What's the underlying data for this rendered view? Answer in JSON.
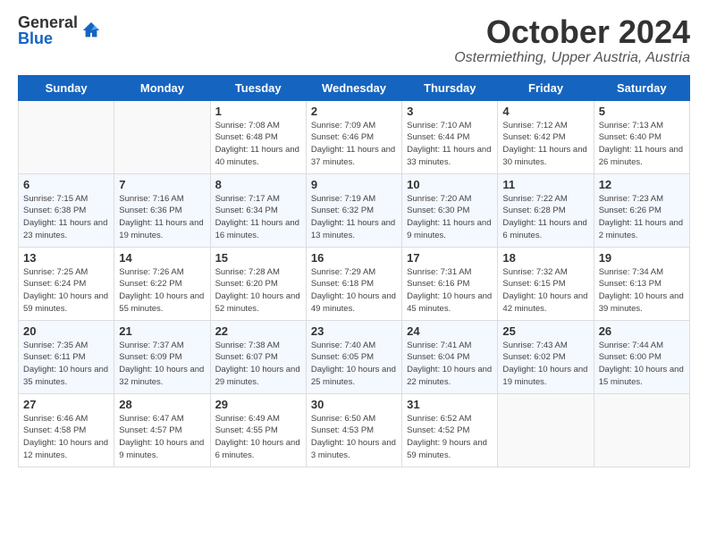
{
  "header": {
    "logo_general": "General",
    "logo_blue": "Blue",
    "month_title": "October 2024",
    "subtitle": "Ostermiething, Upper Austria, Austria"
  },
  "days_of_week": [
    "Sunday",
    "Monday",
    "Tuesday",
    "Wednesday",
    "Thursday",
    "Friday",
    "Saturday"
  ],
  "weeks": [
    [
      {
        "day": "",
        "empty": true
      },
      {
        "day": "",
        "empty": true
      },
      {
        "day": "1",
        "sunrise": "7:08 AM",
        "sunset": "6:48 PM",
        "daylight": "11 hours and 40 minutes."
      },
      {
        "day": "2",
        "sunrise": "7:09 AM",
        "sunset": "6:46 PM",
        "daylight": "11 hours and 37 minutes."
      },
      {
        "day": "3",
        "sunrise": "7:10 AM",
        "sunset": "6:44 PM",
        "daylight": "11 hours and 33 minutes."
      },
      {
        "day": "4",
        "sunrise": "7:12 AM",
        "sunset": "6:42 PM",
        "daylight": "11 hours and 30 minutes."
      },
      {
        "day": "5",
        "sunrise": "7:13 AM",
        "sunset": "6:40 PM",
        "daylight": "11 hours and 26 minutes."
      }
    ],
    [
      {
        "day": "6",
        "sunrise": "7:15 AM",
        "sunset": "6:38 PM",
        "daylight": "11 hours and 23 minutes."
      },
      {
        "day": "7",
        "sunrise": "7:16 AM",
        "sunset": "6:36 PM",
        "daylight": "11 hours and 19 minutes."
      },
      {
        "day": "8",
        "sunrise": "7:17 AM",
        "sunset": "6:34 PM",
        "daylight": "11 hours and 16 minutes."
      },
      {
        "day": "9",
        "sunrise": "7:19 AM",
        "sunset": "6:32 PM",
        "daylight": "11 hours and 13 minutes."
      },
      {
        "day": "10",
        "sunrise": "7:20 AM",
        "sunset": "6:30 PM",
        "daylight": "11 hours and 9 minutes."
      },
      {
        "day": "11",
        "sunrise": "7:22 AM",
        "sunset": "6:28 PM",
        "daylight": "11 hours and 6 minutes."
      },
      {
        "day": "12",
        "sunrise": "7:23 AM",
        "sunset": "6:26 PM",
        "daylight": "11 hours and 2 minutes."
      }
    ],
    [
      {
        "day": "13",
        "sunrise": "7:25 AM",
        "sunset": "6:24 PM",
        "daylight": "10 hours and 59 minutes."
      },
      {
        "day": "14",
        "sunrise": "7:26 AM",
        "sunset": "6:22 PM",
        "daylight": "10 hours and 55 minutes."
      },
      {
        "day": "15",
        "sunrise": "7:28 AM",
        "sunset": "6:20 PM",
        "daylight": "10 hours and 52 minutes."
      },
      {
        "day": "16",
        "sunrise": "7:29 AM",
        "sunset": "6:18 PM",
        "daylight": "10 hours and 49 minutes."
      },
      {
        "day": "17",
        "sunrise": "7:31 AM",
        "sunset": "6:16 PM",
        "daylight": "10 hours and 45 minutes."
      },
      {
        "day": "18",
        "sunrise": "7:32 AM",
        "sunset": "6:15 PM",
        "daylight": "10 hours and 42 minutes."
      },
      {
        "day": "19",
        "sunrise": "7:34 AM",
        "sunset": "6:13 PM",
        "daylight": "10 hours and 39 minutes."
      }
    ],
    [
      {
        "day": "20",
        "sunrise": "7:35 AM",
        "sunset": "6:11 PM",
        "daylight": "10 hours and 35 minutes."
      },
      {
        "day": "21",
        "sunrise": "7:37 AM",
        "sunset": "6:09 PM",
        "daylight": "10 hours and 32 minutes."
      },
      {
        "day": "22",
        "sunrise": "7:38 AM",
        "sunset": "6:07 PM",
        "daylight": "10 hours and 29 minutes."
      },
      {
        "day": "23",
        "sunrise": "7:40 AM",
        "sunset": "6:05 PM",
        "daylight": "10 hours and 25 minutes."
      },
      {
        "day": "24",
        "sunrise": "7:41 AM",
        "sunset": "6:04 PM",
        "daylight": "10 hours and 22 minutes."
      },
      {
        "day": "25",
        "sunrise": "7:43 AM",
        "sunset": "6:02 PM",
        "daylight": "10 hours and 19 minutes."
      },
      {
        "day": "26",
        "sunrise": "7:44 AM",
        "sunset": "6:00 PM",
        "daylight": "10 hours and 15 minutes."
      }
    ],
    [
      {
        "day": "27",
        "sunrise": "6:46 AM",
        "sunset": "4:58 PM",
        "daylight": "10 hours and 12 minutes."
      },
      {
        "day": "28",
        "sunrise": "6:47 AM",
        "sunset": "4:57 PM",
        "daylight": "10 hours and 9 minutes."
      },
      {
        "day": "29",
        "sunrise": "6:49 AM",
        "sunset": "4:55 PM",
        "daylight": "10 hours and 6 minutes."
      },
      {
        "day": "30",
        "sunrise": "6:50 AM",
        "sunset": "4:53 PM",
        "daylight": "10 hours and 3 minutes."
      },
      {
        "day": "31",
        "sunrise": "6:52 AM",
        "sunset": "4:52 PM",
        "daylight": "9 hours and 59 minutes."
      },
      {
        "day": "",
        "empty": true
      },
      {
        "day": "",
        "empty": true
      }
    ]
  ],
  "cell_labels": {
    "sunrise": "Sunrise:",
    "sunset": "Sunset:",
    "daylight": "Daylight:"
  }
}
